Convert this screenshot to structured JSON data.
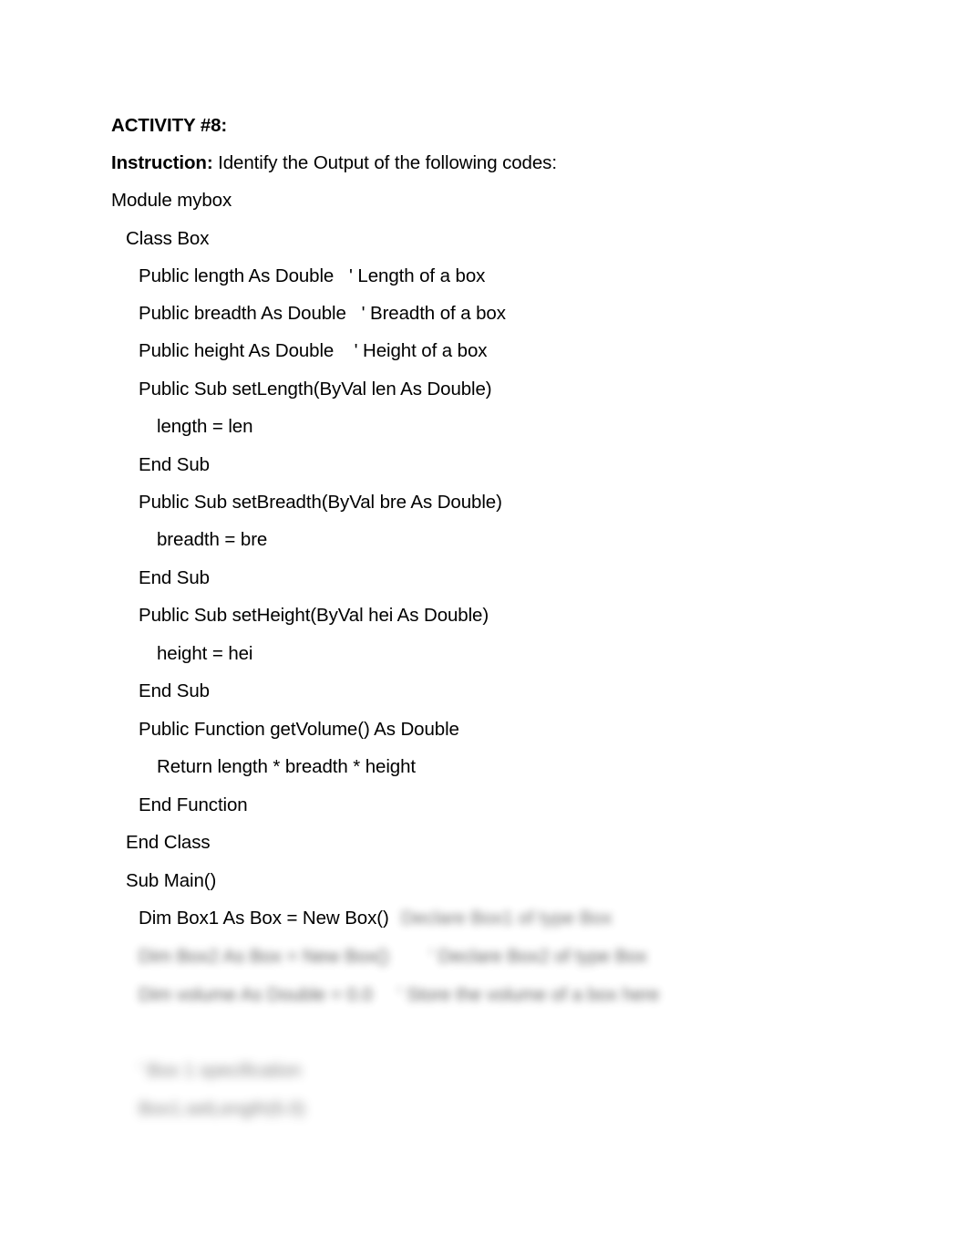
{
  "document": {
    "heading": "ACTIVITY #8:",
    "instruction_label": "Instruction:",
    "instruction_text": " Identify the Output of the following codes:",
    "code_lines": [
      {
        "text": "Module mybox",
        "indent": 0
      },
      {
        "text": "Class Box",
        "indent": 1
      },
      {
        "text": "Public length As Double   ' Length of a box",
        "indent": 2
      },
      {
        "text": "Public breadth As Double   ' Breadth of a box",
        "indent": 2
      },
      {
        "text": "Public height As Double    ' Height of a box",
        "indent": 2
      },
      {
        "text": "Public Sub setLength(ByVal len As Double)",
        "indent": 2
      },
      {
        "text": "length = len",
        "indent": 3
      },
      {
        "text": "End Sub",
        "indent": 2
      },
      {
        "text": "Public Sub setBreadth(ByVal bre As Double)",
        "indent": 2
      },
      {
        "text": "breadth = bre",
        "indent": 3
      },
      {
        "text": "End Sub",
        "indent": 2
      },
      {
        "text": "Public Sub setHeight(ByVal hei As Double)",
        "indent": 2
      },
      {
        "text": "height = hei",
        "indent": 3
      },
      {
        "text": "End Sub",
        "indent": 2
      },
      {
        "text": "Public Function getVolume() As Double",
        "indent": 2
      },
      {
        "text": "Return length * breadth * height",
        "indent": 3
      },
      {
        "text": "End Function",
        "indent": 2
      },
      {
        "text": "End Class",
        "indent": 1
      },
      {
        "text": "Sub Main()",
        "indent": 1
      },
      {
        "text": "Dim Box1 As Box = New Box()",
        "indent": 2
      }
    ],
    "redacted_comment_on_dim_line": "Declare Box1 of type Box",
    "redacted_lines": [
      {
        "text": "Dim Box2 As Box = New Box()        ' Declare Box2 of type Box",
        "indent": 2
      },
      {
        "text": "Dim volume As Double = 0.0     ' Store the volume of a box here",
        "indent": 2
      },
      {
        "text": "' Box 1 specification",
        "indent": 2
      },
      {
        "text": "Box1.setLength(6.0)",
        "indent": 2
      }
    ]
  }
}
